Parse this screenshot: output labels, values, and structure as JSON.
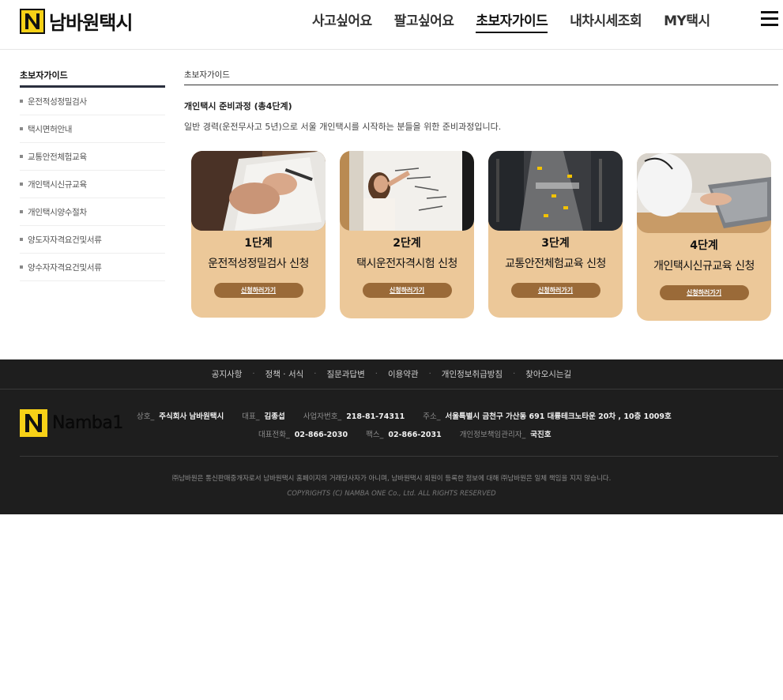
{
  "header": {
    "logo_text": "남바원택시",
    "nav": [
      {
        "label": "사고싶어요"
      },
      {
        "label": "팔고싶어요"
      },
      {
        "label": "초보자가이드"
      },
      {
        "label": "내차시세조회"
      },
      {
        "label": "MY택시"
      }
    ],
    "active_nav": "초보자가이드"
  },
  "sidebar": {
    "title": "초보자가이드",
    "items": [
      {
        "label": "운전적성정밀검사"
      },
      {
        "label": "택시면허안내"
      },
      {
        "label": "교통안전체험교육"
      },
      {
        "label": "개인택시신규교육"
      },
      {
        "label": "개인택시양수절차"
      },
      {
        "label": "양도자자격요건및서류"
      },
      {
        "label": "양수자자격요건및서류"
      }
    ]
  },
  "main": {
    "breadcrumb": "초보자가이드",
    "section_title": "개인택시 준비과정 (총4단계)",
    "section_desc": "일반 경력(운전무사고 5년)으로 서울 개인택시를 시작하는 분들을 위한 준비과정입니다.",
    "steps": [
      {
        "step": "1단계",
        "name": "운전적성정밀검사 신청",
        "button": "신청하러가기"
      },
      {
        "step": "2단계",
        "name": "택시운전자격시험 신청",
        "button": "신청하러가기"
      },
      {
        "step": "3단계",
        "name": "교통안전체험교육 신청",
        "button": "신청하러가기"
      },
      {
        "step": "4단계",
        "name": "개인택시신규교육 신청",
        "button": "신청하러가기"
      }
    ],
    "photo_texts": {
      "whiteboard": "PROJECT PROPOSAL"
    }
  },
  "footer": {
    "links": [
      {
        "label": "공지사항"
      },
      {
        "label": "정책 · 서식"
      },
      {
        "label": "질문과답변"
      },
      {
        "label": "이용약관"
      },
      {
        "label": "개인정보취급방침"
      },
      {
        "label": "찾아오시는길"
      }
    ],
    "logo_text": "Namba1",
    "company_label": "상호_",
    "company": "주식회사 남바원택시",
    "ceo_label": "대표_",
    "ceo": "김종섭",
    "biz_no_label": "사업자번호_",
    "biz_no": "218-81-74311",
    "address_label": "주소_",
    "address": "서울특별시 금천구 가산동 691 대륭테크노타운 20차 , 10층 1009호",
    "phone_label": "대표전화_",
    "phone": "02-866-2030",
    "fax_label": "팩스_",
    "fax": "02-866-2031",
    "privacy_label": "개인정보책임관리자_",
    "privacy": "국진호",
    "disclaimer": "㈜남바원은 통신판매중개자로서 남바원택시 홈페이지의 거래당사자가 아니며, 남바원택시 회원이 등록한 정보에 대해 ㈜남바원은 일체 책임을 지지 않습니다.",
    "copyright": "COPYRIGHTS (C) NAMBA ONE Co., Ltd. ALL RIGHTS RESERVED"
  },
  "colors": {
    "card_bg": "#ecc899",
    "card_button": "#9a6a38",
    "logo_yellow": "#f7d117",
    "footer_bg": "#1e1e1e"
  }
}
